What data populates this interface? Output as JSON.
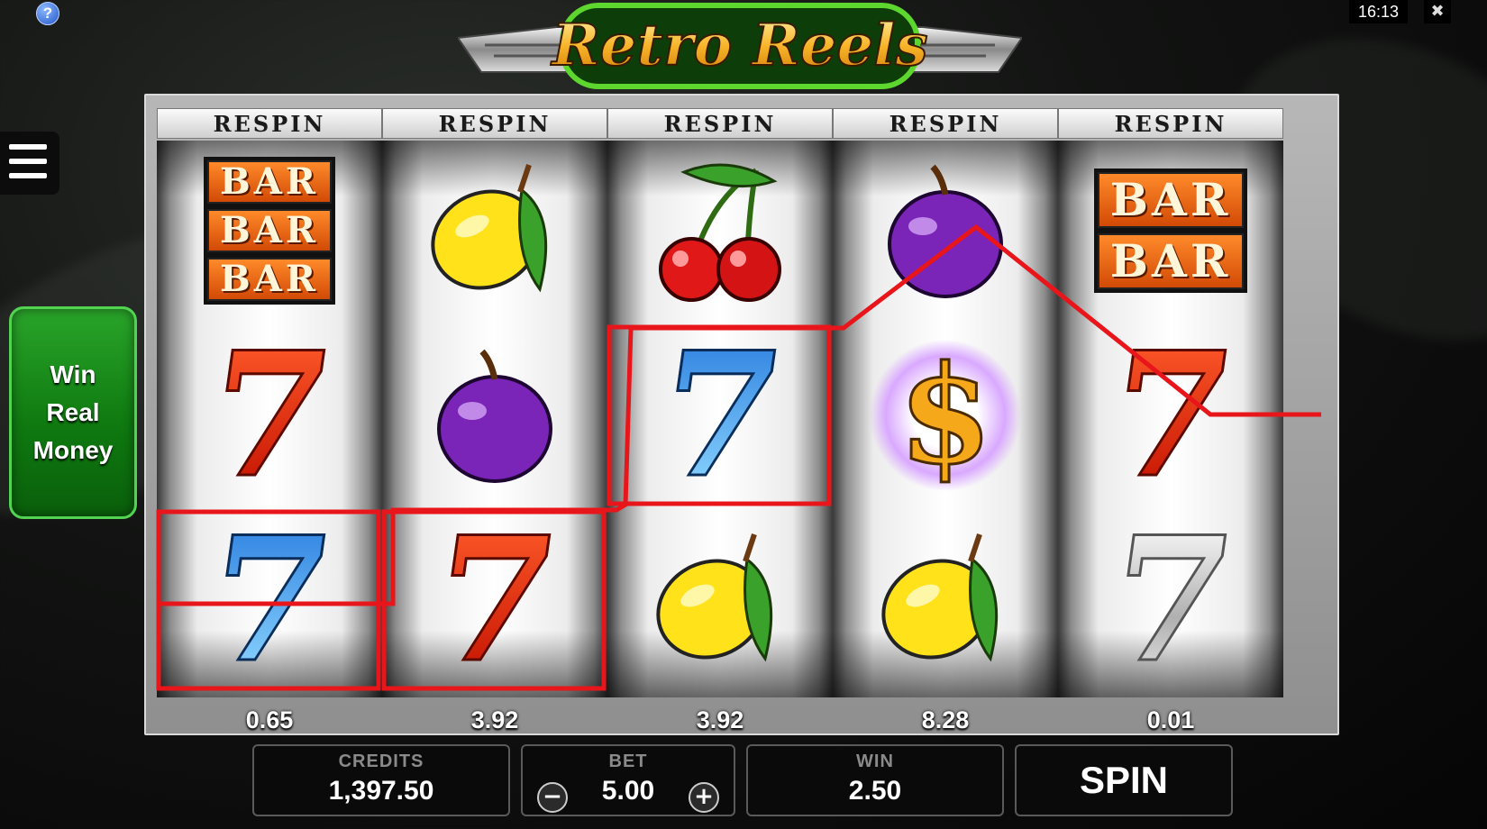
{
  "game": {
    "title": "Retro Reels"
  },
  "topbar": {
    "help_label": "?",
    "time": "16:13",
    "close_glyph": "✖"
  },
  "sidebar": {
    "win_real_money_lines": [
      "Win",
      "Real",
      "Money"
    ]
  },
  "reels": [
    {
      "label": "RESPIN",
      "value": "0.65",
      "symbols": [
        "bar-triple",
        "seven-red",
        "seven-blue"
      ]
    },
    {
      "label": "RESPIN",
      "value": "3.92",
      "symbols": [
        "lemon",
        "plum",
        "seven-red"
      ]
    },
    {
      "label": "RESPIN",
      "value": "3.92",
      "symbols": [
        "cherries",
        "seven-blue",
        "lemon"
      ]
    },
    {
      "label": "RESPIN",
      "value": "8.28",
      "symbols": [
        "plum",
        "dollar",
        "lemon"
      ]
    },
    {
      "label": "RESPIN",
      "value": "0.01",
      "symbols": [
        "bar-double",
        "seven-red",
        "seven-silver"
      ]
    }
  ],
  "bar_text": "BAR",
  "seven_text": "7",
  "dollar_text": "$",
  "winning_highlights": [
    {
      "reel": 1,
      "row": 3
    },
    {
      "reel": 2,
      "row": 3
    },
    {
      "reel": 3,
      "row": 2
    }
  ],
  "payline_color": "#e8161b",
  "footer": {
    "credits_label": "CREDITS",
    "credits_value": "1,397.50",
    "bet_label": "BET",
    "bet_value": "5.00",
    "bet_minus": "−",
    "bet_plus": "+",
    "win_label": "WIN",
    "win_value": "2.50",
    "spin_label": "SPIN"
  }
}
